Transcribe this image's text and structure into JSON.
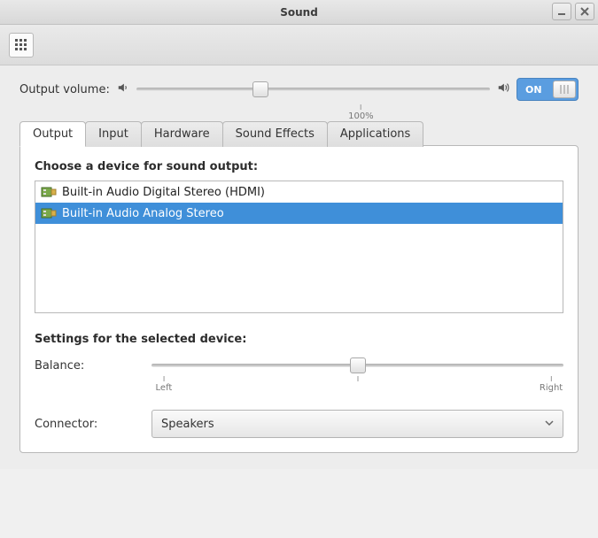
{
  "window": {
    "title": "Sound"
  },
  "volume": {
    "label": "Output volume:",
    "percent": 35,
    "mark_label": "100%",
    "toggle_label": "ON",
    "toggle_state": true
  },
  "tabs": [
    {
      "id": "output",
      "label": "Output",
      "active": true
    },
    {
      "id": "input",
      "label": "Input",
      "active": false
    },
    {
      "id": "hardware",
      "label": "Hardware",
      "active": false
    },
    {
      "id": "effects",
      "label": "Sound Effects",
      "active": false
    },
    {
      "id": "apps",
      "label": "Applications",
      "active": false
    }
  ],
  "output_panel": {
    "choose_label": "Choose a device for sound output:",
    "devices": [
      {
        "name": "Built-in Audio Digital Stereo (HDMI)",
        "selected": false
      },
      {
        "name": "Built-in Audio Analog Stereo",
        "selected": true
      }
    ],
    "settings_label": "Settings for the selected device:",
    "balance": {
      "label": "Balance:",
      "value": 50,
      "left_label": "Left",
      "right_label": "Right"
    },
    "connector": {
      "label": "Connector:",
      "selected": "Speakers"
    }
  }
}
